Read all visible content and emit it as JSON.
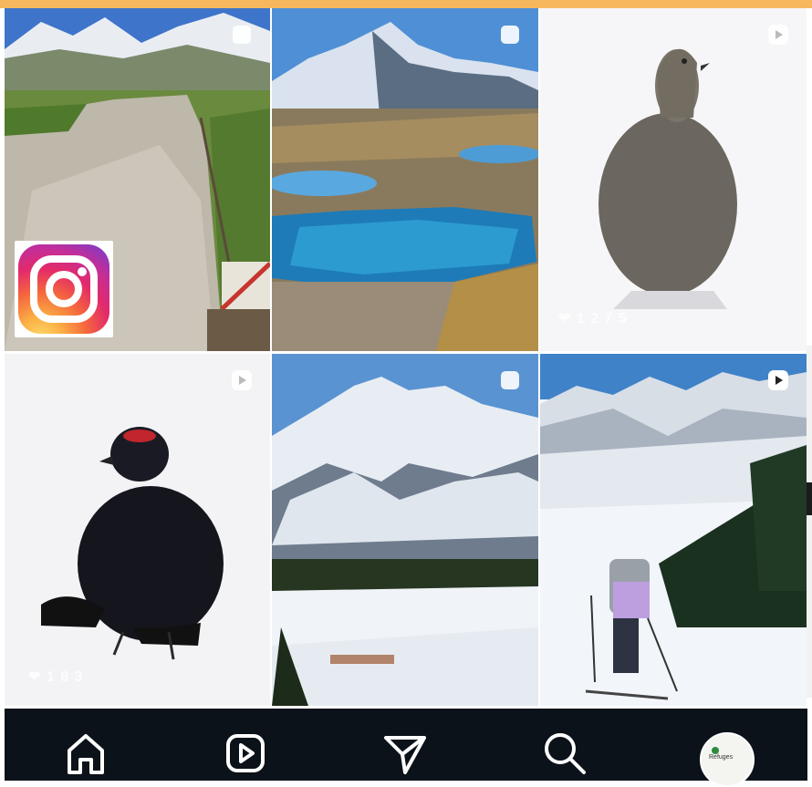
{
  "grid": {
    "tiles": [
      {
        "id": "tile-1",
        "type": "post"
      },
      {
        "id": "tile-2",
        "type": "post"
      },
      {
        "id": "tile-3",
        "type": "reel",
        "caption": "❤ 1 2 7 5"
      },
      {
        "id": "tile-4",
        "type": "reel",
        "caption": "❤ 1 8 3"
      },
      {
        "id": "tile-5",
        "type": "post"
      },
      {
        "id": "tile-6",
        "type": "reel"
      }
    ]
  },
  "overlay": {
    "logo_icon": "instagram-logo"
  },
  "navbar": {
    "items": [
      {
        "name": "home",
        "icon": "home-icon"
      },
      {
        "name": "reels",
        "icon": "reels-icon"
      },
      {
        "name": "direct",
        "icon": "paper-plane-icon"
      },
      {
        "name": "search",
        "icon": "search-icon"
      },
      {
        "name": "profile",
        "icon": "avatar"
      }
    ]
  },
  "profile_text": "Refuges"
}
